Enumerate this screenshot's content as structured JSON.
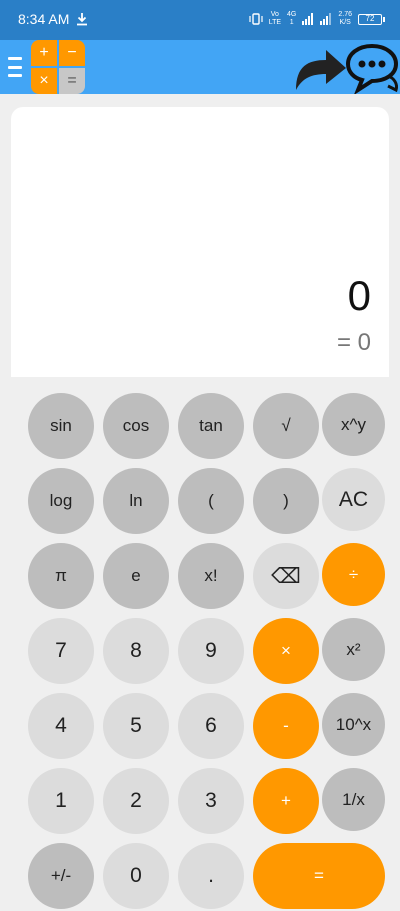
{
  "status_bar": {
    "time": "8:34 AM",
    "net_top": "Vo",
    "net_bottom": "LTE",
    "net2_top": "4G",
    "net2_bottom": "1",
    "speed_top": "2.76",
    "speed_bottom": "K/S",
    "battery": "72",
    "icons": [
      "download-icon",
      "vibrate-icon",
      "signal-icon",
      "battery-icon"
    ]
  },
  "app_bar": {
    "logo": {
      "tl": "+",
      "tr": "−",
      "bl": "×",
      "br": "="
    },
    "icons": [
      "menu-icon",
      "share-arrow-icon",
      "chat-icon"
    ],
    "colors": {
      "bar": "#42a5f5",
      "status": "#2a7fc7",
      "accent": "#ff9800"
    }
  },
  "display": {
    "expression": "0",
    "result": "= 0"
  },
  "keypad": {
    "sin": "sin",
    "cos": "cos",
    "tan": "tan",
    "sqrt": "√",
    "pow": "x^y",
    "log": "log",
    "ln": "ln",
    "lparen": "(",
    "rparen": ")",
    "ac": "AC",
    "pi": "π",
    "e": "e",
    "fact": "x!",
    "backspace": "⌫",
    "divide": "÷",
    "seven": "7",
    "eight": "8",
    "nine": "9",
    "multiply": "×",
    "square": "x²",
    "four": "4",
    "five": "5",
    "six": "6",
    "minus": "-",
    "pow10": "10^x",
    "one": "1",
    "two": "2",
    "three": "3",
    "plus": "+",
    "reciprocal": "1/x",
    "sign": "+/-",
    "zero": "0",
    "dot": ".",
    "equals": "="
  }
}
